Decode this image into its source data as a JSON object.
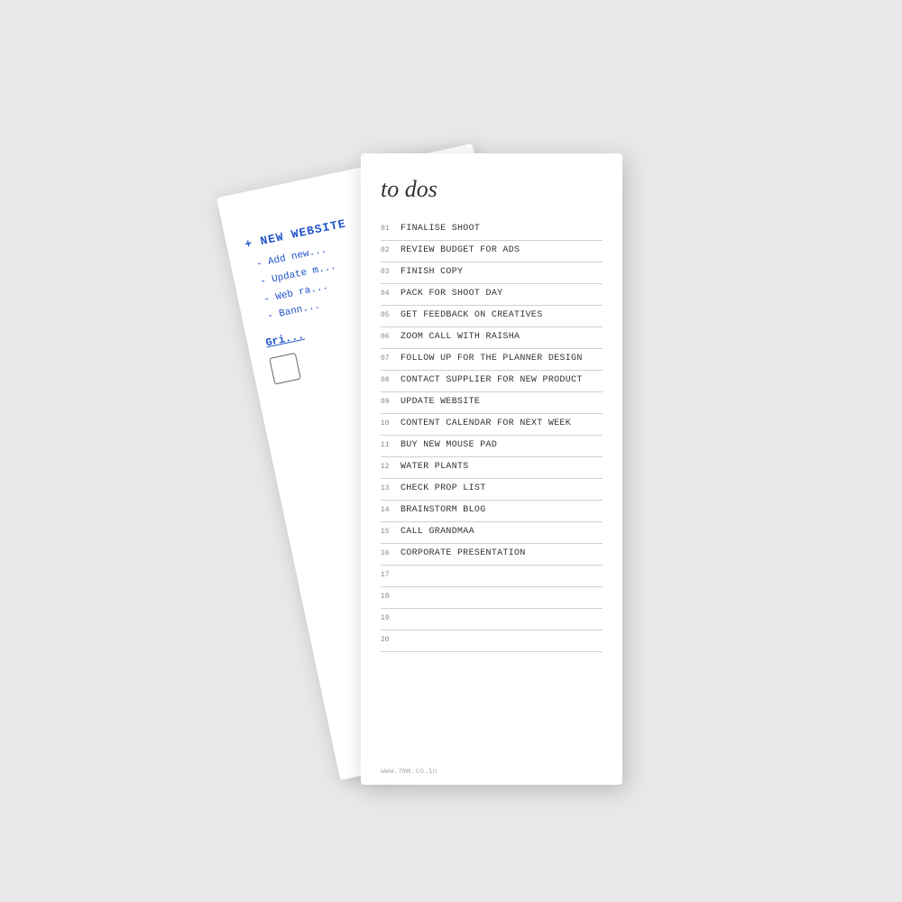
{
  "scene": {
    "title": "to dos",
    "website": "www.7mm.co.in",
    "items": [
      {
        "num": "01",
        "text": "Finalise shoot",
        "blue": false
      },
      {
        "num": "02",
        "text": "Review budget for ads",
        "blue": false
      },
      {
        "num": "03",
        "text": "Finish copy",
        "blue": false
      },
      {
        "num": "04",
        "text": "Pack for shoot day",
        "blue": false
      },
      {
        "num": "05",
        "text": "Get feedback on creatives",
        "blue": false
      },
      {
        "num": "06",
        "text": "Zoom call with Raisha",
        "blue": false
      },
      {
        "num": "07",
        "text": "Follow up for the planner design",
        "blue": false
      },
      {
        "num": "08",
        "text": "Contact supplier for new product",
        "blue": false
      },
      {
        "num": "09",
        "text": "Update website",
        "blue": false
      },
      {
        "num": "10",
        "text": "Content calendar for next week",
        "blue": false
      },
      {
        "num": "11",
        "text": "Buy new mouse pad",
        "blue": false
      },
      {
        "num": "12",
        "text": "Water plants",
        "blue": false
      },
      {
        "num": "13",
        "text": "Check prop list",
        "blue": false
      },
      {
        "num": "14",
        "text": "Brainstorm blog",
        "blue": false
      },
      {
        "num": "15",
        "text": "Call grandmaa",
        "blue": false
      },
      {
        "num": "16",
        "text": "Corporate presentation",
        "blue": false
      },
      {
        "num": "17",
        "text": "",
        "blue": false
      },
      {
        "num": "18",
        "text": "",
        "blue": false
      },
      {
        "num": "19",
        "text": "",
        "blue": false
      },
      {
        "num": "20",
        "text": "",
        "blue": false
      }
    ],
    "back": {
      "title": "+ New website",
      "items": [
        "- Add new...",
        "- Update m...",
        "- Web ra...",
        "- Bann..."
      ],
      "section": "Gri..."
    }
  }
}
